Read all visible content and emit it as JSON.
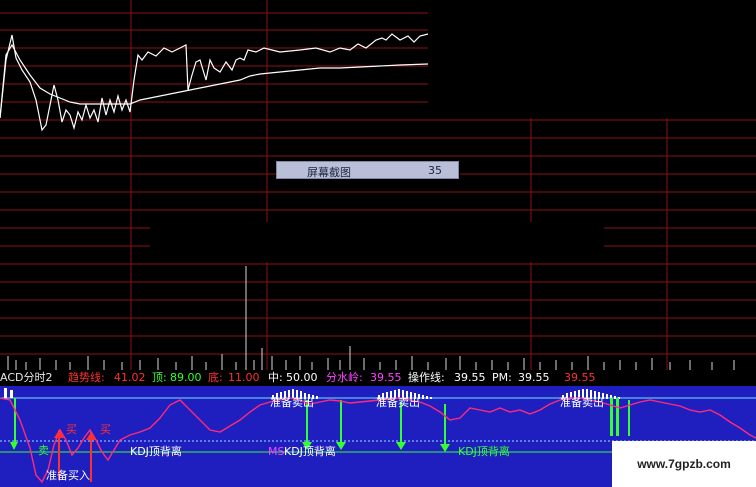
{
  "tooltip": {
    "label": "屏幕截图",
    "value": "35"
  },
  "indicator": {
    "name": "ACD分时2",
    "trend_label": "趋势线:",
    "trend_value": "41.02",
    "top_label": "顶:",
    "top_value": "89.00",
    "bottom_label": "底:",
    "bottom_value": "11.00",
    "mid_label": "中:",
    "mid_value": "50.00",
    "water_label": "分水岭:",
    "water_value": "39.55",
    "op_label": "操作线:",
    "op_value": "39.55",
    "pm_label": "PM:",
    "pm_value": "39.55",
    "extra_value": "39.55"
  },
  "signals": {
    "prepare_sell": "准备卖出",
    "prepare_buy": "准备买入",
    "sell": "卖",
    "buy": "买",
    "kdj_top": "KDJ顶背离",
    "kdj_top_short": "KDJ顶背离",
    "ms": "MS"
  },
  "watermark": "www.7gpzb.com",
  "colors": {
    "price": "#ffffff",
    "grid": "#8b1010",
    "panel": "#1f1fc0",
    "indicator_line": "#ff2a7a",
    "signal_green": "#33ff33",
    "signal_red": "#ff3030"
  }
}
